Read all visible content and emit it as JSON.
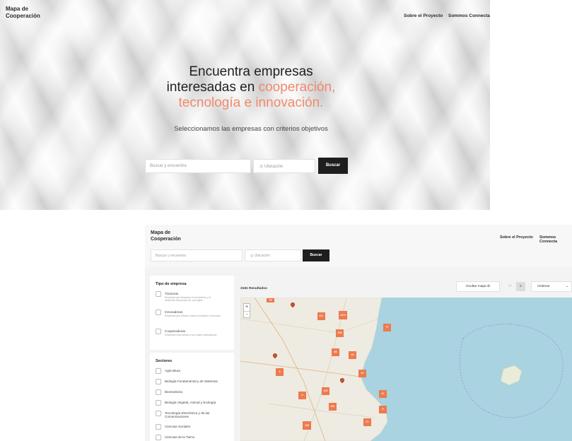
{
  "hero": {
    "logo": "Mapa de Cooperación",
    "nav": [
      "Sobre el Proyecto",
      "Sommos Connecta"
    ],
    "title_line1": "Encuentra empresas",
    "title_line2_pre": "interesadas en ",
    "title_line2_accent": "cooperación,",
    "title_line3_accent": "tecnología e innovación.",
    "subtitle": "Seleccionamos las empresas con criterios objetivos",
    "search_placeholder": "Buscar y encuentra",
    "location_placeholder": "Ubicación",
    "search_button": "Buscar"
  },
  "app": {
    "logo": "Mapa de Cooperación",
    "nav": [
      "Sobre el Proyecto",
      "Sommos Connecta"
    ],
    "search_placeholder": "Buscar y encuentra",
    "location_placeholder": "Ubicación",
    "search_button": "Buscar",
    "company_type": {
      "title": "Tipo de empresa",
      "options": [
        {
          "label": "Tractoras",
          "desc": "Empresas que fomentan el crecimiento y el desarrollo económico de una región"
        },
        {
          "label": "Innovadoras",
          "desc": "Empresas que ofrecen nuevos productos o servicios"
        },
        {
          "label": "Cooperadoras",
          "desc": "Empresas más activas y con mayor participación"
        }
      ]
    },
    "sectors": {
      "title": "Sectores",
      "items": [
        "Agricultura",
        "Biología Fundamental y de Sistemas",
        "Biomedicina",
        "Biología Vegetal, Animal y Ecología",
        "Tecnología Electrónica y de las Comunicaciones",
        "Ciencias Sociales",
        "Ciencias de la Tierra"
      ]
    },
    "results": "3181 Resultados",
    "hide_map": "Ocultar mapa",
    "sort_label": "Ordenar",
    "zoom_in": "+",
    "zoom_out": "-",
    "clusters": [
      "75",
      "117",
      "1272",
      "77",
      "139",
      "88",
      "16",
      "3",
      "67",
      "4",
      "120",
      "27",
      "191",
      "9",
      "140",
      "27"
    ]
  },
  "colors": {
    "accent": "#f08a6c",
    "cluster": "#ee7a4d",
    "button_dark": "#1e1e1e",
    "sea": "#a9d3e0",
    "land": "#eeebe3"
  }
}
